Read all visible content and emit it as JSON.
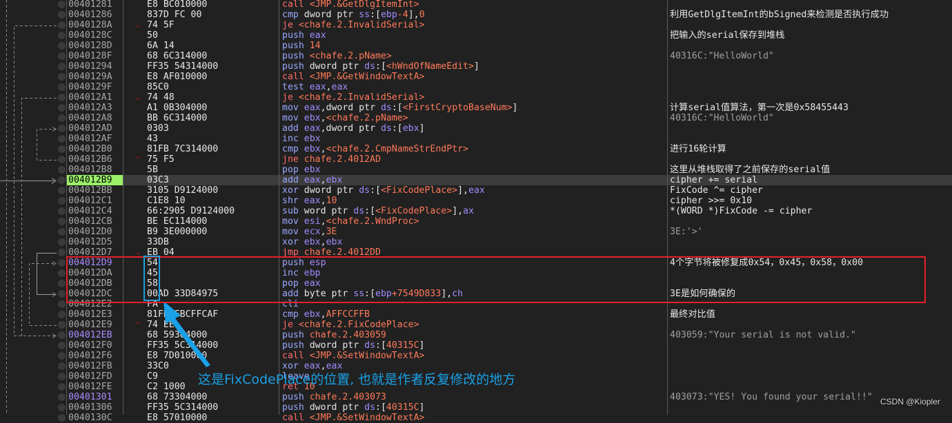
{
  "highlight_colors": {
    "eip_bg": "#9bf068",
    "annotation_box": "#e8202a",
    "bytes_box": "#1aa0e0",
    "annotation_text": "#1aa0e6"
  },
  "rows": [
    {
      "addr": "00401281",
      "bytes": "E8 BC010000",
      "mnem": "call",
      "ops": [
        [
          "sym",
          "<JMP.&GetDlgItemInt>"
        ]
      ],
      "kind": "call",
      "comment": "",
      "cstyle": "plain"
    },
    {
      "addr": "00401286",
      "bytes": "837D FC 00",
      "mnem": "cmp",
      "ops": [
        [
          "txt",
          "dword ptr "
        ],
        [
          "seg",
          "ss"
        ],
        [
          "txt",
          ":["
        ],
        [
          "reg",
          "ebp"
        ],
        [
          "imm",
          "-4"
        ],
        [
          "txt",
          "],"
        ],
        [
          "imm",
          "0"
        ]
      ],
      "kind": "nrm",
      "comment": "利用GetDlgItemInt的bSigned来检测是否执行成功",
      "cstyle": "plain"
    },
    {
      "addr": "0040128A",
      "bytes": "74 5F",
      "mark": "v",
      "mnem": "je",
      "ops": [
        [
          "sym",
          "<chafe.2.InvalidSerial>"
        ]
      ],
      "kind": "jmp",
      "comment": "",
      "cstyle": "plain"
    },
    {
      "addr": "0040128C",
      "bytes": "50",
      "mnem": "push",
      "ops": [
        [
          "reg",
          "eax"
        ]
      ],
      "kind": "nrm",
      "comment": "把输入的serial保存到堆栈",
      "cstyle": "plain"
    },
    {
      "addr": "0040128D",
      "bytes": "6A 14",
      "mnem": "push",
      "ops": [
        [
          "imm",
          "14"
        ]
      ],
      "kind": "nrm",
      "comment": "",
      "cstyle": "plain"
    },
    {
      "addr": "0040128F",
      "bytes": "68 6C314000",
      "mnem": "push",
      "ops": [
        [
          "sym",
          "<chafe.2.pName>"
        ]
      ],
      "kind": "nrm",
      "comment": "40316C:\"HelloWorld\"",
      "cstyle": "str"
    },
    {
      "addr": "00401294",
      "bytes": "FF35 54314000",
      "mnem": "push",
      "ops": [
        [
          "txt",
          "dword ptr "
        ],
        [
          "seg",
          "ds"
        ],
        [
          "txt",
          ":["
        ],
        [
          "sym",
          "<hWndOfNameEdit>"
        ],
        [
          "txt",
          "]"
        ]
      ],
      "kind": "nrm",
      "comment": "",
      "cstyle": "plain"
    },
    {
      "addr": "0040129A",
      "bytes": "E8 AF010000",
      "mnem": "call",
      "ops": [
        [
          "sym",
          "<JMP.&GetWindowTextA>"
        ]
      ],
      "kind": "call",
      "comment": "",
      "cstyle": "plain"
    },
    {
      "addr": "0040129F",
      "bytes": "85C0",
      "mnem": "test",
      "ops": [
        [
          "reg",
          "eax"
        ],
        [
          "txt",
          ","
        ],
        [
          "reg",
          "eax"
        ]
      ],
      "kind": "nrm",
      "comment": "",
      "cstyle": "plain"
    },
    {
      "addr": "004012A1",
      "bytes": "74 48",
      "mark": "v",
      "mnem": "je",
      "ops": [
        [
          "sym",
          "<chafe.2.InvalidSerial>"
        ]
      ],
      "kind": "jmp",
      "comment": "",
      "cstyle": "plain"
    },
    {
      "addr": "004012A3",
      "bytes": "A1 0B304000",
      "mnem": "mov",
      "ops": [
        [
          "reg",
          "eax"
        ],
        [
          "txt",
          ",dword ptr "
        ],
        [
          "seg",
          "ds"
        ],
        [
          "txt",
          ":["
        ],
        [
          "sym",
          "<FirstCryptoBaseNum>"
        ],
        [
          "txt",
          "]"
        ]
      ],
      "kind": "nrm",
      "comment": "计算serial值算法，第一次是0x58455443",
      "cstyle": "plain"
    },
    {
      "addr": "004012A8",
      "bytes": "BB 6C314000",
      "mnem": "mov",
      "ops": [
        [
          "reg",
          "ebx"
        ],
        [
          "txt",
          ","
        ],
        [
          "sym",
          "<chafe.2.pName>"
        ]
      ],
      "kind": "nrm",
      "comment": "40316C:\"HelloWorld\"",
      "cstyle": "str"
    },
    {
      "addr": "004012AD",
      "bytes": "0303",
      "mnem": "add",
      "ops": [
        [
          "reg",
          "eax"
        ],
        [
          "txt",
          ",dword ptr "
        ],
        [
          "seg",
          "ds"
        ],
        [
          "txt",
          ":["
        ],
        [
          "reg",
          "ebx"
        ],
        [
          "txt",
          "]"
        ]
      ],
      "kind": "nrm",
      "comment": "",
      "cstyle": "plain"
    },
    {
      "addr": "004012AF",
      "bytes": "43",
      "mnem": "inc",
      "ops": [
        [
          "reg",
          "ebx"
        ]
      ],
      "kind": "nrm",
      "comment": "",
      "cstyle": "plain"
    },
    {
      "addr": "004012B0",
      "bytes": "81FB 7C314000",
      "mnem": "cmp",
      "ops": [
        [
          "reg",
          "ebx"
        ],
        [
          "txt",
          ","
        ],
        [
          "sym",
          "<chafe.2.CmpNameStrEndPtr>"
        ]
      ],
      "kind": "nrm",
      "comment": "进行16轮计算",
      "cstyle": "plain"
    },
    {
      "addr": "004012B6",
      "bytes": "75 F5",
      "mark": "^",
      "mnem": "jne",
      "ops": [
        [
          "sym",
          "chafe.2.4012AD"
        ]
      ],
      "kind": "jmp",
      "comment": "",
      "cstyle": "plain"
    },
    {
      "addr": "004012B8",
      "bytes": "5B",
      "mnem": "pop",
      "ops": [
        [
          "reg",
          "ebx"
        ]
      ],
      "kind": "nrm",
      "comment": "这里从堆栈取得了之前保存的serial值",
      "cstyle": "plain"
    },
    {
      "addr": "004012B9",
      "bytes": "03C3",
      "mnem": "add",
      "ops": [
        [
          "reg",
          "eax"
        ],
        [
          "txt",
          ","
        ],
        [
          "reg",
          "ebx"
        ]
      ],
      "kind": "nrm",
      "comment": "cipher += serial",
      "cstyle": "plain",
      "eip": true
    },
    {
      "addr": "004012BB",
      "bytes": "3105 D9124000",
      "mnem": "xor",
      "ops": [
        [
          "txt",
          "dword ptr "
        ],
        [
          "seg",
          "ds"
        ],
        [
          "txt",
          ":["
        ],
        [
          "sym",
          "<FixCodePlace>"
        ],
        [
          "txt",
          "],"
        ],
        [
          "reg",
          "eax"
        ]
      ],
      "kind": "nrm",
      "comment": "FixCode ^= cipher",
      "cstyle": "plain"
    },
    {
      "addr": "004012C1",
      "bytes": "C1E8 10",
      "mnem": "shr",
      "ops": [
        [
          "reg",
          "eax"
        ],
        [
          "txt",
          ","
        ],
        [
          "imm",
          "10"
        ]
      ],
      "kind": "nrm",
      "comment": "cipher >>= 0x10",
      "cstyle": "plain"
    },
    {
      "addr": "004012C4",
      "bytes": "66:2905 D9124000",
      "mnem": "sub",
      "ops": [
        [
          "txt",
          "word ptr "
        ],
        [
          "seg",
          "ds"
        ],
        [
          "txt",
          ":["
        ],
        [
          "sym",
          "<FixCodePlace>"
        ],
        [
          "txt",
          "],"
        ],
        [
          "reg",
          "ax"
        ]
      ],
      "kind": "nrm",
      "comment": "*(WORD *)FixCode -= cipher",
      "cstyle": "plain"
    },
    {
      "addr": "004012CB",
      "bytes": "BE EC114000",
      "mnem": "mov",
      "ops": [
        [
          "reg",
          "esi"
        ],
        [
          "txt",
          ","
        ],
        [
          "sym",
          "<chafe.2.WndProc>"
        ]
      ],
      "kind": "nrm",
      "comment": "",
      "cstyle": "plain"
    },
    {
      "addr": "004012D0",
      "bytes": "B9 3E000000",
      "mnem": "mov",
      "ops": [
        [
          "reg",
          "ecx"
        ],
        [
          "txt",
          ","
        ],
        [
          "imm",
          "3E"
        ]
      ],
      "kind": "nrm",
      "comment": "3E:'>'",
      "cstyle": "str"
    },
    {
      "addr": "004012D5",
      "bytes": "33DB",
      "mnem": "xor",
      "ops": [
        [
          "reg",
          "ebx"
        ],
        [
          "txt",
          ","
        ],
        [
          "reg",
          "ebx"
        ]
      ],
      "kind": "nrm",
      "comment": "",
      "cstyle": "plain"
    },
    {
      "addr": "004012D7",
      "bytes": "EB 04",
      "mark": "v",
      "mnem": "jmp",
      "ops": [
        [
          "sym",
          "chafe.2.4012DD"
        ]
      ],
      "kind": "jmp",
      "comment": "",
      "cstyle": "plain"
    },
    {
      "addr": "004012D9",
      "bytes": "54",
      "mnem": "push",
      "ops": [
        [
          "reg",
          "esp"
        ]
      ],
      "kind": "nrm",
      "comment": "4个字节将被修复成0x54，0x45，0x58，0x00",
      "cstyle": "plain",
      "label": true
    },
    {
      "addr": "004012DA",
      "bytes": "45",
      "mnem": "inc",
      "ops": [
        [
          "reg",
          "ebp"
        ]
      ],
      "kind": "nrm",
      "comment": "",
      "cstyle": "plain"
    },
    {
      "addr": "004012DB",
      "bytes": "58",
      "mnem": "pop",
      "ops": [
        [
          "reg",
          "eax"
        ]
      ],
      "kind": "nrm",
      "comment": "",
      "cstyle": "plain"
    },
    {
      "addr": "004012DC",
      "bytes": "00AD 33D84975",
      "mnem": "add",
      "ops": [
        [
          "txt",
          "byte ptr "
        ],
        [
          "seg",
          "ss"
        ],
        [
          "txt",
          ":["
        ],
        [
          "reg",
          "ebp"
        ],
        [
          "imm",
          "+7549D833"
        ],
        [
          "txt",
          "],"
        ],
        [
          "reg",
          "ch"
        ]
      ],
      "kind": "nrm",
      "comment": "3E是如何确保的",
      "cstyle": "plain"
    },
    {
      "addr": "004012E2",
      "bytes": "FA",
      "mnem": "cli",
      "ops": [],
      "kind": "nrm",
      "comment": "",
      "cstyle": "plain"
    },
    {
      "addr": "004012E3",
      "bytes": "81FB FBCFFCAF",
      "mnem": "cmp",
      "ops": [
        [
          "reg",
          "ebx"
        ],
        [
          "txt",
          ","
        ],
        [
          "imm",
          "AFFCCFFB"
        ]
      ],
      "kind": "nrm",
      "comment": "最终对比值",
      "cstyle": "plain"
    },
    {
      "addr": "004012E9",
      "bytes": "74 EE",
      "mark": "^",
      "mnem": "je",
      "ops": [
        [
          "sym",
          "<chafe.2.FixCodePlace>"
        ]
      ],
      "kind": "jmp",
      "comment": "",
      "cstyle": "plain"
    },
    {
      "addr": "004012EB",
      "bytes": "68 59304000",
      "mnem": "push",
      "ops": [
        [
          "sym",
          "chafe.2.403059"
        ]
      ],
      "kind": "nrm",
      "comment": "403059:\"Your serial is not valid.\"",
      "cstyle": "str",
      "label": true
    },
    {
      "addr": "004012F0",
      "bytes": "FF35 5C314000",
      "mnem": "push",
      "ops": [
        [
          "txt",
          "dword ptr "
        ],
        [
          "seg",
          "ds"
        ],
        [
          "txt",
          ":["
        ],
        [
          "imm",
          "40315C"
        ],
        [
          "txt",
          "]"
        ]
      ],
      "kind": "nrm",
      "comment": "",
      "cstyle": "plain"
    },
    {
      "addr": "004012F6",
      "bytes": "E8 7D010000",
      "mnem": "call",
      "ops": [
        [
          "sym",
          "<JMP.&SetWindowTextA>"
        ]
      ],
      "kind": "call",
      "comment": "",
      "cstyle": "plain"
    },
    {
      "addr": "004012FB",
      "bytes": "33C0",
      "mnem": "xor",
      "ops": [
        [
          "reg",
          "eax"
        ],
        [
          "txt",
          ","
        ],
        [
          "reg",
          "eax"
        ]
      ],
      "kind": "nrm",
      "comment": "",
      "cstyle": "plain"
    },
    {
      "addr": "004012FD",
      "bytes": "C9",
      "mnem": "leave",
      "ops": [],
      "kind": "nrm",
      "comment": "",
      "cstyle": "plain"
    },
    {
      "addr": "004012FE",
      "bytes": "C2 1000",
      "mnem": "ret",
      "ops": [
        [
          "imm",
          "10"
        ]
      ],
      "kind": "call",
      "comment": "",
      "cstyle": "plain"
    },
    {
      "addr": "00401301",
      "bytes": "68 73304000",
      "mnem": "push",
      "ops": [
        [
          "sym",
          "chafe.2.403073"
        ]
      ],
      "kind": "nrm",
      "comment": "403073:\"YES! You found your serial!!\"",
      "cstyle": "str",
      "label": true
    },
    {
      "addr": "00401306",
      "bytes": "FF35 5C314000",
      "mnem": "push",
      "ops": [
        [
          "txt",
          "dword ptr "
        ],
        [
          "seg",
          "ds"
        ],
        [
          "txt",
          ":["
        ],
        [
          "imm",
          "40315C"
        ],
        [
          "txt",
          "]"
        ]
      ],
      "kind": "nrm",
      "comment": "",
      "cstyle": "plain"
    },
    {
      "addr": "0040130C",
      "bytes": "E8 57010000",
      "mnem": "call",
      "ops": [
        [
          "sym",
          "<JMP.&SetWindowTextA>"
        ]
      ],
      "kind": "call",
      "comment": "",
      "cstyle": "plain"
    }
  ],
  "annotation": {
    "text": "这是FixCodePlace的位置, 也就是作者反复修改的地方"
  },
  "watermark": "CSDN @Kiopler"
}
